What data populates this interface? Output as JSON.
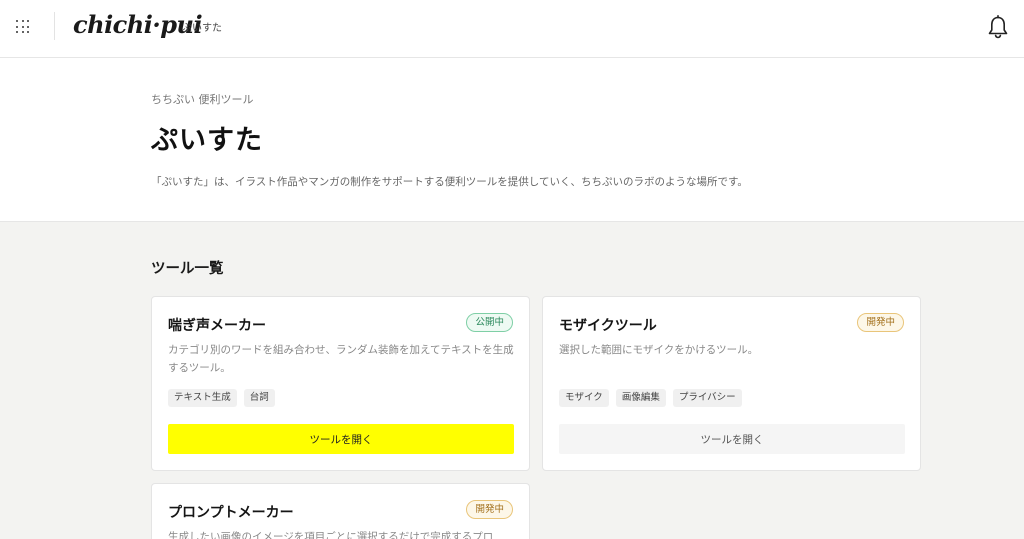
{
  "header": {
    "logo": "chichi·pui",
    "logo_sub": "ぷいすた",
    "icons": {
      "menu": "grid-icon",
      "notifications": "bell-icon"
    }
  },
  "hero": {
    "breadcrumb": "ちちぷい 便利ツール",
    "title": "ぷいすた",
    "description": "「ぷいすた」は、イラスト作品やマンガの制作をサポートする便利ツールを提供していく、ちちぷいのラボのような場所です。"
  },
  "tools": {
    "section_title": "ツール一覧",
    "items": [
      {
        "title": "喘ぎ声メーカー",
        "status": "公開中",
        "description": "カテゴリ別のワードを組み合わせ、ランダム装飾を加えてテキストを生成するツール。",
        "tags": [
          "テキスト生成",
          "台詞"
        ],
        "button": "ツールを開く"
      },
      {
        "title": "モザイクツール",
        "status": "開発中",
        "description": "選択した範囲にモザイクをかけるツール。",
        "tags": [
          "モザイク",
          "画像編集",
          "プライバシー"
        ],
        "button": "ツールを開く"
      },
      {
        "title": "プロンプトメーカー",
        "status": "開発中",
        "description": "生成したい画像のイメージを項目ごとに選択するだけで完成するプロ"
      }
    ]
  },
  "colors": {
    "accent_button": "#ffff00",
    "public_badge": "#2e8a5e",
    "dev_badge": "#a3701c",
    "page_background": "#f3f3f1"
  }
}
